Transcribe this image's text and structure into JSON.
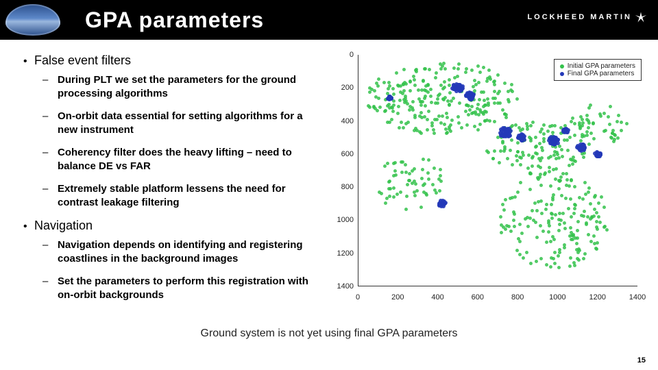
{
  "header": {
    "title": "GPA parameters",
    "brand_right": "LOCKHEED MARTIN"
  },
  "bullets": {
    "top1": "False event filters",
    "sub1a": "During PLT we set the parameters for the ground processing algorithms",
    "sub1b": "On-orbit data essential for setting algorithms for a new instrument",
    "sub1c": "Coherency filter does the heavy lifting – need to balance DE vs FAR",
    "sub1d": "Extremely stable platform lessens the need for contrast leakage filtering",
    "top2": "Navigation",
    "sub2a": "Navigation depends on identifying and registering coastlines in the background images",
    "sub2b": "Set the parameters to perform this registration with on-orbit backgrounds"
  },
  "figure": {
    "legend_a": "Initial GPA parameters",
    "legend_b": "Final GPA parameters",
    "legend_a_color": "#34c24b",
    "legend_b_color": "#2439b8",
    "caption": "Ground system is not yet using final GPA parameters"
  },
  "chart_data": {
    "type": "scatter",
    "title": "",
    "xlabel": "",
    "ylabel": "",
    "xlim": [
      0,
      1400
    ],
    "ylim": [
      0,
      1400
    ],
    "y_inverted": true,
    "y_ticks": [
      0,
      200,
      400,
      600,
      800,
      1000,
      1200,
      1400
    ],
    "x_ticks": [
      0,
      200,
      400,
      600,
      800,
      1000,
      1200,
      1400
    ],
    "series": [
      {
        "name": "Initial GPA parameters",
        "color": "#34c24b",
        "note": "dense scatter across continental outline; not individually readable"
      },
      {
        "name": "Final GPA parameters",
        "color": "#2439b8",
        "note": "clustered subset overlapping initial; concentrated near (500,200),(740,480),(980,520),(1120,560),(420,900)"
      }
    ]
  },
  "page_number": "15"
}
